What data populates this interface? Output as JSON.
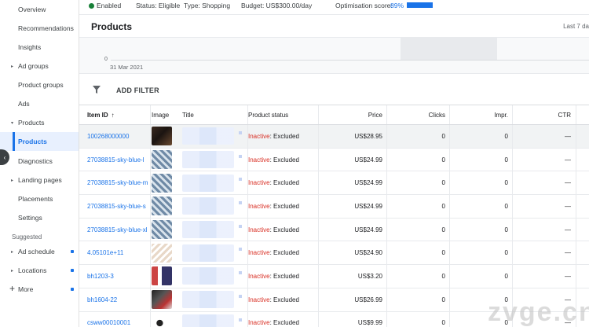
{
  "sidebar": {
    "items": [
      {
        "label": "Overview",
        "caret": false
      },
      {
        "label": "Recommendations",
        "caret": false
      },
      {
        "label": "Insights",
        "caret": false
      },
      {
        "label": "Ad groups",
        "caret": true
      },
      {
        "label": "Product groups",
        "caret": false
      },
      {
        "label": "Ads",
        "caret": false
      },
      {
        "label": "Products",
        "caret": true
      },
      {
        "label": "Products",
        "caret": false,
        "active": true
      },
      {
        "label": "Diagnostics",
        "caret": false
      },
      {
        "label": "Landing pages",
        "caret": true
      },
      {
        "label": "Placements",
        "caret": false
      },
      {
        "label": "Settings",
        "caret": false
      }
    ],
    "suggested_label": "Suggested",
    "suggested_items": [
      {
        "label": "Ad schedule",
        "caret": true
      },
      {
        "label": "Locations",
        "caret": true
      }
    ],
    "more_label": "More"
  },
  "statusbar": {
    "enabled": "Enabled",
    "status": "Status: Eligible",
    "type": "Type: Shopping",
    "budget": "Budget: US$300.00/day",
    "optimisation_label": "Optimisation score:",
    "optimisation_value": "89%"
  },
  "header": {
    "title": "Products",
    "date_range": "Last 7 da"
  },
  "chart": {
    "zero_label": "0",
    "date_label": "31 Mar 2021"
  },
  "filter": {
    "add_filter": "ADD FILTER"
  },
  "table": {
    "columns": {
      "item_id": "Item ID",
      "image": "Image",
      "title": "Title",
      "product_status": "Product status",
      "price": "Price",
      "clicks": "Clicks",
      "impr": "Impr.",
      "ctr": "CTR"
    },
    "rows": [
      {
        "item_id": "100268000000",
        "status_a": "Inactive",
        "status_b": ": Excluded",
        "price": "US$28.95",
        "clicks": "0",
        "impr": "0",
        "ctr": "—"
      },
      {
        "item_id": "27038815-sky-blue-l",
        "status_a": "Inactive",
        "status_b": ": Excluded",
        "price": "US$24.99",
        "clicks": "0",
        "impr": "0",
        "ctr": "—"
      },
      {
        "item_id": "27038815-sky-blue-m",
        "status_a": "Inactive",
        "status_b": ": Excluded",
        "price": "US$24.99",
        "clicks": "0",
        "impr": "0",
        "ctr": "—"
      },
      {
        "item_id": "27038815-sky-blue-s",
        "status_a": "Inactive",
        "status_b": ": Excluded",
        "price": "US$24.99",
        "clicks": "0",
        "impr": "0",
        "ctr": "—"
      },
      {
        "item_id": "27038815-sky-blue-xl",
        "status_a": "Inactive",
        "status_b": ": Excluded",
        "price": "US$24.99",
        "clicks": "0",
        "impr": "0",
        "ctr": "—"
      },
      {
        "item_id": "4.05101e+11",
        "status_a": "Inactive",
        "status_b": ": Excluded",
        "price": "US$24.90",
        "clicks": "0",
        "impr": "0",
        "ctr": "—"
      },
      {
        "item_id": "bh1203-3",
        "status_a": "Inactive",
        "status_b": ": Excluded",
        "price": "US$3.20",
        "clicks": "0",
        "impr": "0",
        "ctr": "—"
      },
      {
        "item_id": "bh1604-22",
        "status_a": "Inactive",
        "status_b": ": Excluded",
        "price": "US$26.99",
        "clicks": "0",
        "impr": "0",
        "ctr": "—"
      },
      {
        "item_id": "csww00010001",
        "status_a": "Inactive",
        "status_b": ": Excluded",
        "price": "US$9.99",
        "clicks": "0",
        "impr": "0",
        "ctr": "—"
      }
    ]
  },
  "watermark": "zvge.cn",
  "colors": {
    "accent": "#1a73e8",
    "inactive": "#d93025",
    "enabled": "#188038"
  }
}
